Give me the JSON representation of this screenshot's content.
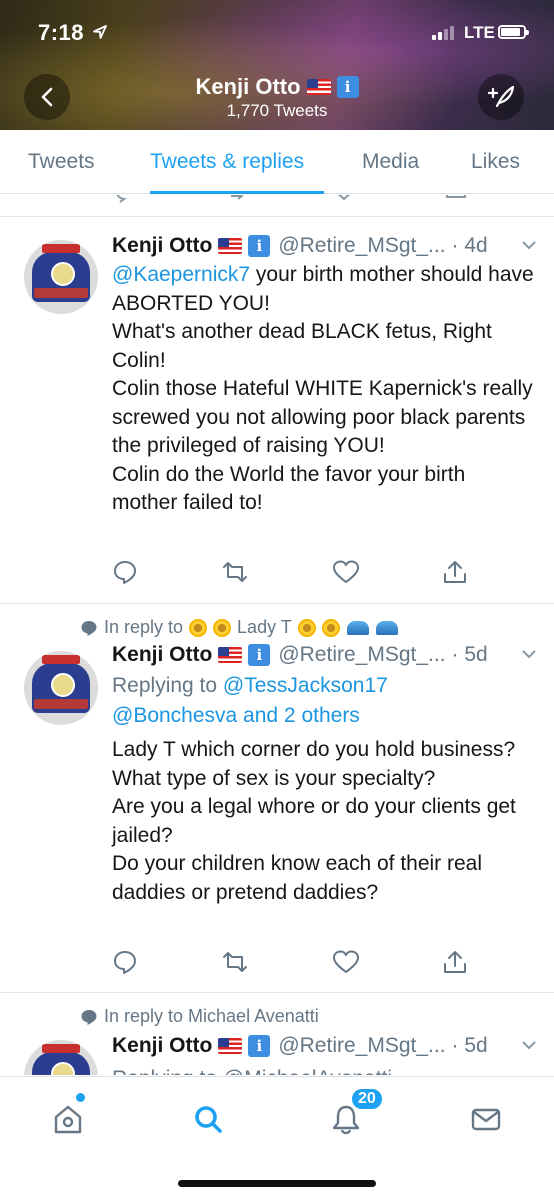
{
  "status": {
    "time": "7:18",
    "network": "LTE"
  },
  "header": {
    "name": "Kenji Otto",
    "tweet_count": "1,770 Tweets"
  },
  "tabs": [
    {
      "label": "Tweets",
      "active": false
    },
    {
      "label": "Tweets & replies",
      "active": true
    },
    {
      "label": "Media",
      "active": false
    },
    {
      "label": "Likes",
      "active": false
    }
  ],
  "tweets": [
    {
      "name": "Kenji Otto",
      "handle": "@Retire_MSgt_...",
      "time": "· 4d",
      "mention": "@Kaepernick7",
      "text_rest": " your birth mother should have ABORTED YOU!\nWhat's another dead BLACK fetus, Right Colin!\nColin those Hateful WHITE Kapernick's really screwed you not allowing poor black parents the privileged of raising YOU!\nColin do the World the favor your birth mother failed to!"
    },
    {
      "reply_to_prefix": "In reply to",
      "reply_to_name": "Lady T",
      "name": "Kenji Otto",
      "handle": "@Retire_MSgt_...",
      "time": "· 5d",
      "replying_prefix": "Replying to",
      "replying_user": "@TessJackson17",
      "replying_line2": "@Bonchesva and 2 others",
      "text": "Lady T which corner do you hold business?\nWhat type of sex is your specialty?\nAre you a legal whore or do your clients get jailed?\nDo your children know each of their real daddies or pretend daddies?"
    },
    {
      "reply_to_text": "In reply to Michael Avenatti",
      "name": "Kenji Otto",
      "handle": "@Retire_MSgt_...",
      "time": "· 5d",
      "partial_line": "Replying to @MichaelAvenatti"
    }
  ],
  "bottom_nav": {
    "notifications_count": "20"
  },
  "colors": {
    "accent": "#1da1f2",
    "link": "#1b95e0",
    "muted": "#657786"
  }
}
